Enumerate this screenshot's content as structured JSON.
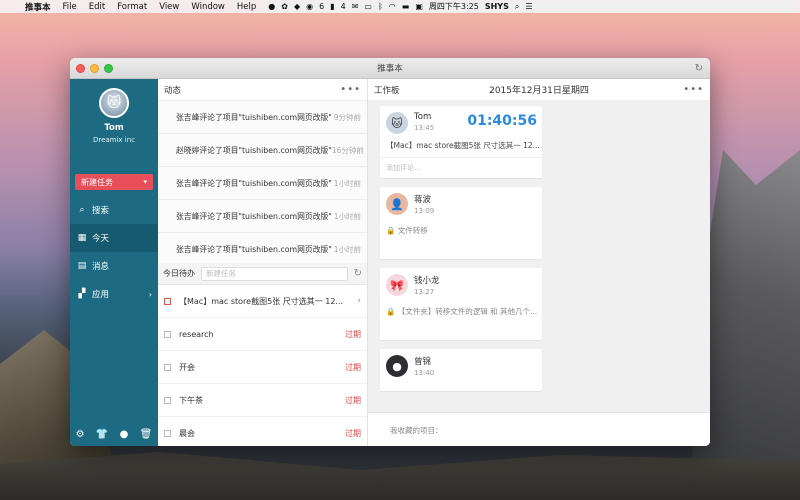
{
  "menubar": {
    "app": "推事本",
    "items": [
      "File",
      "Edit",
      "Format",
      "View",
      "Window",
      "Help"
    ],
    "badge": "6",
    "badge2": "4",
    "clock": "周四下午3:25",
    "user": "SHYS"
  },
  "window": {
    "title": "推事本"
  },
  "sidebar": {
    "user_name": "Tom",
    "org": "Dreamix inc",
    "new_task": "新建任务",
    "nav": [
      {
        "label": "搜索"
      },
      {
        "label": "今天"
      },
      {
        "label": "消息"
      },
      {
        "label": "应用"
      }
    ]
  },
  "feed": {
    "title": "动态",
    "items": [
      {
        "text": "张吉峰评论了项目\"tuishiben.com网页改版\"",
        "time": "9分钟前"
      },
      {
        "text": "赵晓婷评论了项目\"tuishiben.com网页改版\"",
        "time": "16分钟前"
      },
      {
        "text": "张吉峰评论了项目\"tuishiben.com网页改版\"",
        "time": "1小时前"
      },
      {
        "text": "张吉峰评论了项目\"tuishiben.com网页改版\"",
        "time": "1小时前"
      },
      {
        "text": "张吉峰评论了项目\"tuishiben.com网页改版\"",
        "time": "1小时前"
      }
    ]
  },
  "today": {
    "label": "今日待办",
    "placeholder": "新建任务",
    "items": [
      {
        "text": "【Mac】mac store截图5张 尺寸选其一 12...",
        "due": ""
      },
      {
        "text": "research",
        "due": "过期"
      },
      {
        "text": "开会",
        "due": "过期"
      },
      {
        "text": "下午茶",
        "due": "过期"
      },
      {
        "text": "晨会",
        "due": "过期"
      }
    ]
  },
  "workboard": {
    "title": "工作板",
    "date": "2015年12月31日星期四",
    "cards": [
      {
        "name": "Tom",
        "time": "13:45",
        "timer": "01:40:56",
        "line": "【Mac】mac store截图5张 尺寸选其一 12...",
        "comment": "添加评论..."
      },
      {
        "name": "蒋波",
        "time": "13:09",
        "line": "文件转移"
      },
      {
        "name": "钱小龙",
        "time": "13:27",
        "line": "【文件夹】转移文件的逻辑 和 其他几个..."
      },
      {
        "name": "曾锦",
        "time": "13:40"
      }
    ],
    "favorites": "我收藏的项目："
  }
}
